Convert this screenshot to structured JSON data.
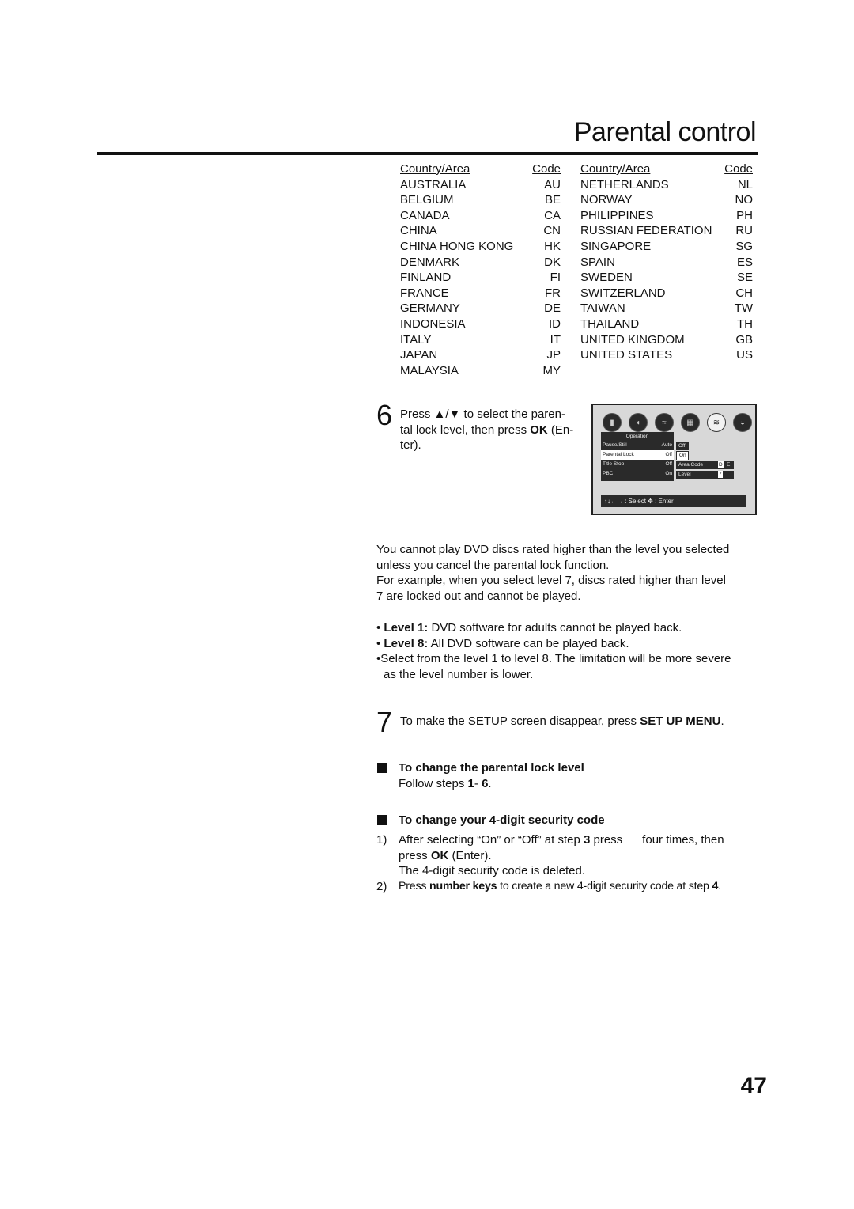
{
  "header": {
    "title": "Parental control"
  },
  "country_table": {
    "col_country": "Country/Area",
    "col_code": "Code",
    "left": [
      {
        "name": "AUSTRALIA",
        "code": "AU"
      },
      {
        "name": "BELGIUM",
        "code": "BE"
      },
      {
        "name": "CANADA",
        "code": "CA"
      },
      {
        "name": "CHINA",
        "code": "CN"
      },
      {
        "name": "CHINA HONG KONG",
        "code": "HK"
      },
      {
        "name": "DENMARK",
        "code": "DK"
      },
      {
        "name": "FINLAND",
        "code": "FI"
      },
      {
        "name": "FRANCE",
        "code": "FR"
      },
      {
        "name": "GERMANY",
        "code": "DE"
      },
      {
        "name": "INDONESIA",
        "code": "ID"
      },
      {
        "name": "ITALY",
        "code": "IT"
      },
      {
        "name": "JAPAN",
        "code": "JP"
      },
      {
        "name": "MALAYSIA",
        "code": "MY"
      }
    ],
    "right": [
      {
        "name": "NETHERLANDS",
        "code": "NL"
      },
      {
        "name": "NORWAY",
        "code": "NO"
      },
      {
        "name": "PHILIPPINES",
        "code": "PH"
      },
      {
        "name": "RUSSIAN FEDERATION",
        "code": "RU"
      },
      {
        "name": "SINGAPORE",
        "code": "SG"
      },
      {
        "name": "SPAIN",
        "code": "ES"
      },
      {
        "name": "SWEDEN",
        "code": "SE"
      },
      {
        "name": "SWITZERLAND",
        "code": "CH"
      },
      {
        "name": "TAIWAN",
        "code": "TW"
      },
      {
        "name": "THAILAND",
        "code": "TH"
      },
      {
        "name": "UNITED KINGDOM",
        "code": "GB"
      },
      {
        "name": "UNITED STATES",
        "code": "US"
      }
    ]
  },
  "step6": {
    "number": "6",
    "t1": "Press ",
    "arrows": "▲/▼",
    "t2": " to select the paren-",
    "t3": "tal lock level, then press ",
    "ok": "OK",
    "t4": " (En-",
    "t5": "ter)."
  },
  "osd": {
    "icons": [
      "picture-icon",
      "audio-icon",
      "language-icon",
      "display-icon",
      "operation-icon",
      "disc-icon"
    ],
    "menu_title": "Operation",
    "rows": [
      {
        "label": "Pause/Still",
        "value": "Auto"
      },
      {
        "label": "Parental Lock",
        "value": "Off"
      },
      {
        "label": "Title Stop",
        "value": "Off"
      },
      {
        "label": "PBC",
        "value": "On"
      }
    ],
    "options": [
      "Off",
      "On"
    ],
    "area_code_label": "Area Code",
    "area_code_value": [
      "D",
      "E"
    ],
    "level_label": "Level",
    "level_value": "7",
    "footer_arrows": "↑↓←→",
    "footer_select": ": Select",
    "footer_enter_icon": "✥",
    "footer_enter": ": Enter"
  },
  "info": {
    "p1": "You cannot play DVD discs rated higher than the level you selected",
    "p2": "unless you cancel the parental lock function.",
    "p3": "For example, when you select level 7, discs rated higher than level",
    "p4": "7 are locked out and cannot be played.",
    "b1_label": "Level 1:",
    "b1_text": " DVD software for adults cannot be played back.",
    "b2_label": "Level 8:",
    "b2_text": " All DVD software can be played back.",
    "b3_line1": "Select from the level 1 to level 8. The limitation will be more severe",
    "b3_line2": "as the level number is lower."
  },
  "step7": {
    "number": "7",
    "text": "To make the SETUP screen disappear, press ",
    "key": "SET UP MENU",
    "end": "."
  },
  "section_level": {
    "heading": "To change the parental lock level",
    "t1": "Follow steps ",
    "s1": "1",
    "t2": "- ",
    "s2": "6",
    "t3": "."
  },
  "section_code": {
    "heading": "To change your 4-digit security code",
    "i1_num": "1)",
    "i1_a": "After selecting “On” or “Off” at step ",
    "i1_step": "3",
    "i1_b": " press      four times, then",
    "i1_c": "press ",
    "i1_ok": "OK",
    "i1_d": " (Enter).",
    "i1_e": "The 4-digit security code is deleted.",
    "i2_num": "2)",
    "i2_a": "Press ",
    "i2_keys": "number keys",
    "i2_b": " to create a new 4-digit security code at step ",
    "i2_step": "4",
    "i2_c": "."
  },
  "footer": {
    "page_number": "47"
  }
}
